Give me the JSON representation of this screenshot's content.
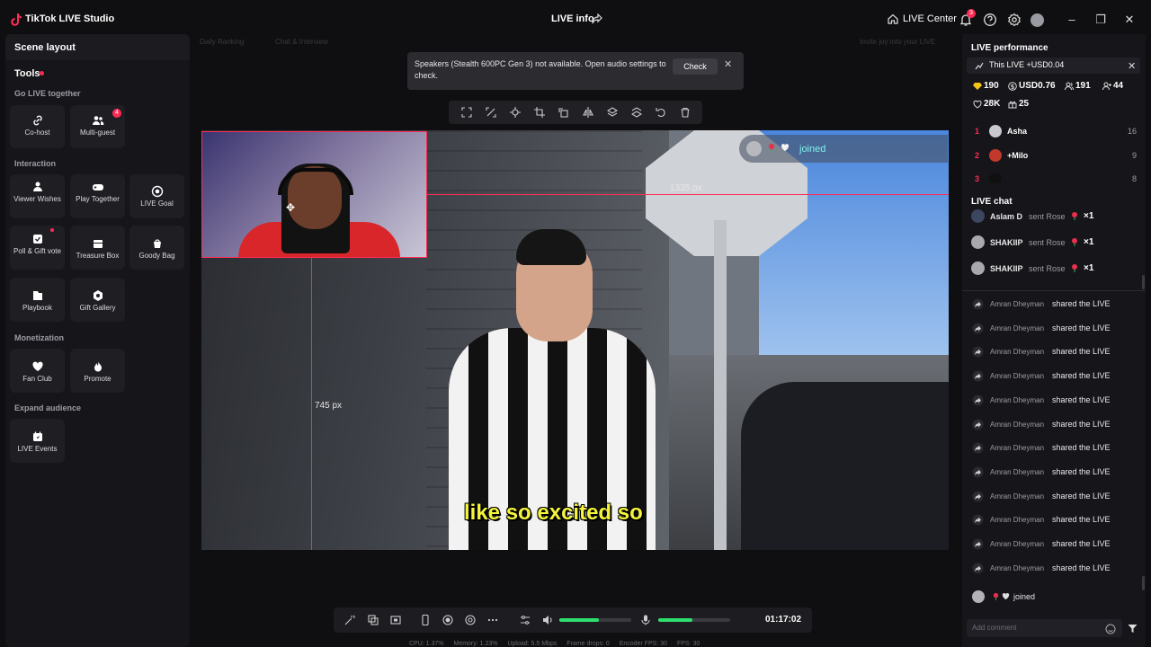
{
  "titlebar": {
    "app_name": "TikTok LIVE Studio",
    "center_title": "LIVE info",
    "live_center": "LIVE Center",
    "notif_count": "3"
  },
  "left": {
    "scene_layout": "Scene layout",
    "tools": "Tools",
    "sections": {
      "go_live_together": "Go LIVE together",
      "interaction": "Interaction",
      "monetization": "Monetization",
      "expand_audience": "Expand audience"
    },
    "tools_items": {
      "cohost": "Co-host",
      "multiguest": "Multi-guest",
      "multiguest_badge": "4",
      "viewer_wishes": "Viewer Wishes",
      "play_together": "Play Together",
      "live_goal": "LIVE Goal",
      "poll_gift": "Poll & Gift vote",
      "treasure_box": "Treasure Box",
      "goody_bag": "Goody Bag",
      "playbook": "Playbook",
      "gift_gallery": "Gift Gallery",
      "fan_club": "Fan Club",
      "promote": "Promote",
      "live_events": "LIVE Events"
    }
  },
  "stage": {
    "tabs": [
      "Daily Ranking",
      "Chat & Interview",
      "Invite joy into your LIVE"
    ],
    "toast_message": "Speakers (Stealth 600PC Gen 3) not available. Open audio settings to check.",
    "toast_check": "Check",
    "subtitle": "like so excited so",
    "joined_text": "joined",
    "width_label": "1335 px",
    "height_label": "745 px",
    "timer": "01:17:02",
    "volume_level": 0.55,
    "mic_level": 0.48,
    "stats": [
      "CPU: 1.37%",
      "Memory: 1.23%",
      "Upload: 5.5 Mbps",
      "Frame drops: 0",
      "Encoder FPS: 30",
      "FPS: 30"
    ]
  },
  "right": {
    "title": "LIVE performance",
    "this_live": "This LIVE +USD0.04",
    "metrics": {
      "diamonds": "190",
      "usd": "USD0.76",
      "viewers": "191",
      "new_followers": "44",
      "likes": "28K",
      "gifters": "25"
    },
    "ranking": [
      {
        "rank": "1",
        "name": "Asha",
        "score": "16"
      },
      {
        "rank": "2",
        "name": "+Milo",
        "score": "9"
      },
      {
        "rank": "3",
        "name": "",
        "score": "8"
      }
    ],
    "chat_title": "LIVE chat",
    "gifts": [
      {
        "name": "Aslam D",
        "action": "sent Rose",
        "count": "×1"
      },
      {
        "name": "SHAKIIP",
        "action": "sent Rose",
        "count": "×1"
      },
      {
        "name": "SHAKIIP",
        "action": "sent Rose",
        "count": "×1"
      }
    ],
    "shares": [
      {
        "name": "Amran Dheyman",
        "action": "shared the LIVE"
      },
      {
        "name": "Amran Dheyman",
        "action": "shared the LIVE"
      },
      {
        "name": "Amran Dheyman",
        "action": "shared the LIVE"
      },
      {
        "name": "Amran Dheyman",
        "action": "shared the LIVE"
      },
      {
        "name": "Amran Dheyman",
        "action": "shared the LIVE"
      },
      {
        "name": "Amran Dheyman",
        "action": "shared the LIVE"
      },
      {
        "name": "Amran Dheyman",
        "action": "shared the LIVE"
      },
      {
        "name": "Amran Dheyman",
        "action": "shared the LIVE"
      },
      {
        "name": "Amran Dheyman",
        "action": "shared the LIVE"
      },
      {
        "name": "Amran Dheyman",
        "action": "shared the LIVE"
      },
      {
        "name": "Amran Dheyman",
        "action": "shared the LIVE"
      },
      {
        "name": "Amran Dheyman",
        "action": "shared the LIVE"
      }
    ],
    "joined_row": "joined",
    "comment_placeholder": "Add comment"
  },
  "colors": {
    "accent": "#fe2c55",
    "level": "#2de06e",
    "joined": "#7ff0ea",
    "subtitle": "#f4f43c"
  }
}
